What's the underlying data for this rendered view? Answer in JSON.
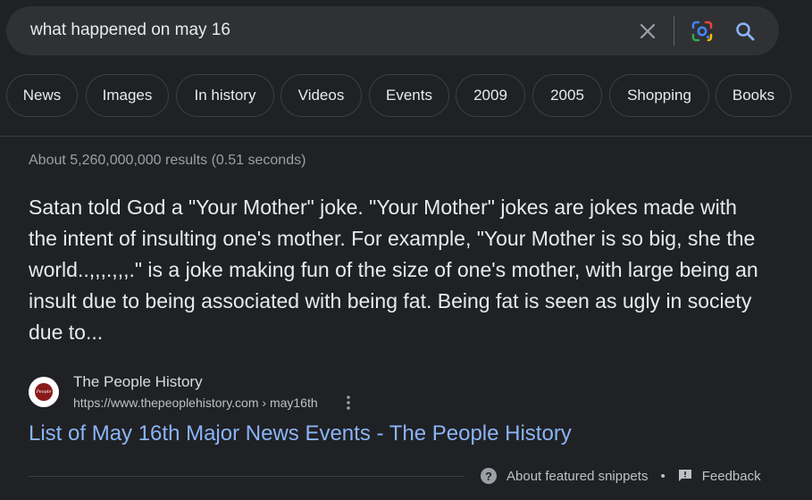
{
  "search": {
    "query": "what happened on may 16"
  },
  "chips": [
    {
      "label": "News"
    },
    {
      "label": "Images"
    },
    {
      "label": "In history"
    },
    {
      "label": "Videos"
    },
    {
      "label": "Events"
    },
    {
      "label": "2009"
    },
    {
      "label": "2005"
    },
    {
      "label": "Shopping"
    },
    {
      "label": "Books"
    }
  ],
  "stats": "About 5,260,000,000 results (0.51 seconds)",
  "snippet": "Satan told God a \"Your Mother\" joke. \"Your Mother\" jokes are jokes made with the intent of insulting one's mother. For example, \"Your Mother is so big, she the world..,,,.,,,.\" is a joke making fun of the size of one's mother, with large being an insult due to being associated with being fat. Being fat is seen as ugly in society due to...",
  "source": {
    "favicon_text": "People",
    "name": "The People History",
    "url": "https://www.thepeoplehistory.com › may16th",
    "title": "List of May 16th Major News Events - The People History"
  },
  "footer": {
    "about": "About featured snippets",
    "separator": "•",
    "feedback": "Feedback"
  },
  "colors": {
    "background": "#202124",
    "search_bar": "#303134",
    "link": "#8ab4f8",
    "muted_text": "#9aa0a6",
    "search_icon": "#8ab4f8"
  },
  "icons": {
    "clear": "close-icon",
    "lens": "google-lens-icon",
    "search": "search-icon",
    "more": "more-vert-icon",
    "help": "help-circle-icon",
    "feedback": "feedback-icon"
  }
}
